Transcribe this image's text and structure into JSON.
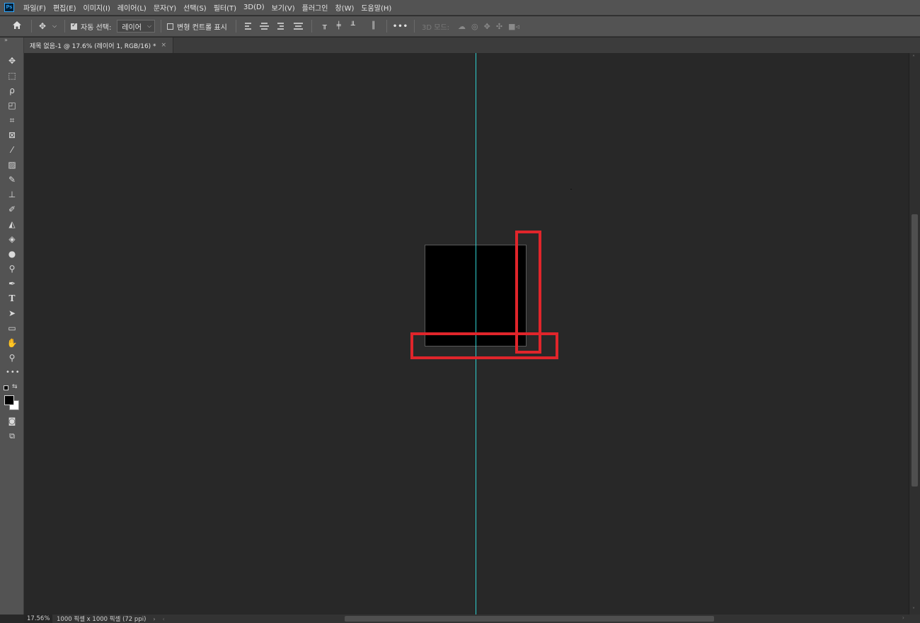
{
  "app": {
    "logo": "Ps"
  },
  "menu": [
    "파일(F)",
    "편집(E)",
    "이미지(I)",
    "레이어(L)",
    "문자(Y)",
    "선택(S)",
    "필터(T)",
    "3D(D)",
    "보기(V)",
    "플러그인",
    "창(W)",
    "도움말(H)"
  ],
  "options": {
    "auto_select_label": "자동 선택:",
    "auto_select_checked": true,
    "auto_select_value": "레이어",
    "transform_label": "변형 컨트롤 표시",
    "transform_checked": false,
    "more_label": "•••",
    "mode_3d_label": "3D 모드:"
  },
  "tab": {
    "title": "제목 없음-1 @ 17.6% (레이어 1, RGB/16) *",
    "close": "×"
  },
  "toolbar": {
    "tools": [
      "move-tool",
      "marquee-tool",
      "lasso-tool",
      "object-select-tool",
      "crop-tool",
      "frame-tool",
      "eyedropper-tool",
      "healing-brush-tool",
      "brush-tool",
      "clone-stamp-tool",
      "history-brush-tool",
      "eraser-tool",
      "paint-bucket-tool",
      "blur-tool",
      "dodge-tool",
      "pen-tool",
      "type-tool",
      "path-select-tool",
      "rectangle-tool",
      "hand-tool",
      "zoom-tool",
      "more-tools"
    ],
    "foreground_color": "#000000",
    "background_color": "#ffffff"
  },
  "canvas": {
    "guide_color": "#2fd0d0",
    "highlight_color": "#e0252b"
  },
  "status": {
    "zoom": "17.56%",
    "doc_info": "1000 픽셀 x 1000 픽셀 (72 ppi)",
    "arrow": "›"
  }
}
